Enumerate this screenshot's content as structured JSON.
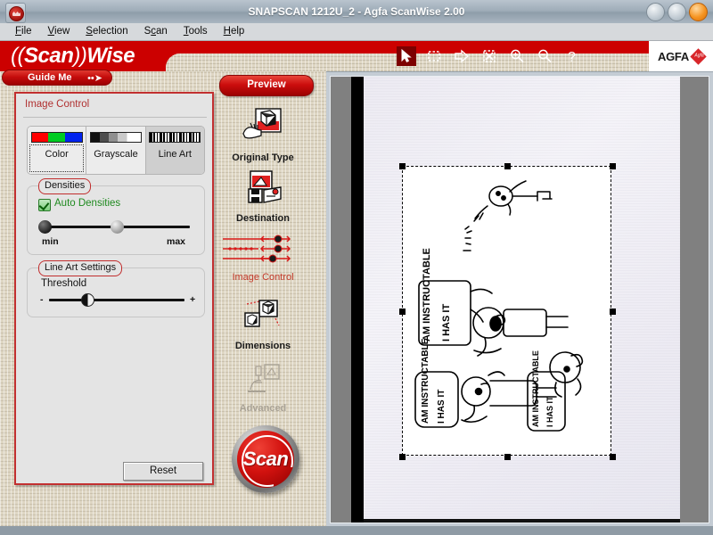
{
  "window": {
    "title": "SNAPSCAN 1212U_2 - Agfa ScanWise 2.00",
    "system_icon": "scanwise-app-icon",
    "buttons": [
      {
        "name": "minimize-button",
        "glyph": ""
      },
      {
        "name": "maximize-button",
        "glyph": ""
      },
      {
        "name": "close-button",
        "glyph": ""
      }
    ]
  },
  "menu": {
    "items": [
      {
        "label": "File",
        "mnemonic": "F"
      },
      {
        "label": "View",
        "mnemonic": "V"
      },
      {
        "label": "Selection",
        "mnemonic": "S"
      },
      {
        "label": "Scan",
        "mnemonic": "c"
      },
      {
        "label": "Tools",
        "mnemonic": "T"
      },
      {
        "label": "Help",
        "mnemonic": "H"
      }
    ]
  },
  "banner": {
    "logo_prefix": "((",
    "logo_scan": "Scan",
    "logo_paren": "))",
    "logo_wise": "Wise",
    "brand": "AGFA",
    "brand_mark": "Agfa",
    "toolbar": [
      {
        "name": "arrow-select-tool",
        "title": "Select",
        "selected": true
      },
      {
        "name": "marquee-tool",
        "title": "Marquee",
        "selected": false
      },
      {
        "name": "arrow-right-tool",
        "title": "Next",
        "selected": false
      },
      {
        "name": "clear-selection-tool",
        "title": "Clear",
        "selected": false
      },
      {
        "name": "zoom-in-tool",
        "title": "Zoom In",
        "selected": false
      },
      {
        "name": "zoom-out-tool",
        "title": "Zoom Out",
        "selected": false
      },
      {
        "name": "help-tool",
        "title": "Help",
        "selected": false
      }
    ]
  },
  "guide_me": {
    "label": "Guide Me",
    "arrow": "••➤"
  },
  "panel": {
    "title": "Image Control",
    "modes": [
      {
        "label": "Color",
        "swatch": "rgb-bars-icon",
        "active": false,
        "focused": true
      },
      {
        "label": "Grayscale",
        "swatch": "gray-ramp-icon",
        "active": false,
        "focused": false
      },
      {
        "label": "Line Art",
        "swatch": "line-art-bars-icon",
        "active": true,
        "focused": false
      }
    ],
    "densities": {
      "caption": "Densities",
      "auto_label": "Auto Densities",
      "auto_checked": true,
      "min_label": "min",
      "max_label": "max",
      "min_value": 0,
      "max_value": 56
    },
    "line_art": {
      "caption": "Line Art Settings",
      "threshold_label": "Threshold",
      "minus": "-",
      "plus": "+",
      "threshold_value": 37
    },
    "reset_label": "Reset"
  },
  "nav": {
    "preview_label": "Preview",
    "items": [
      {
        "label": "Original Type",
        "icon": "original-type-icon",
        "state": "normal"
      },
      {
        "label": "Destination",
        "icon": "destination-icon",
        "state": "normal"
      },
      {
        "label": "Image Control",
        "icon": "image-control-sliders-icon",
        "state": "current"
      },
      {
        "label": "Dimensions",
        "icon": "dimensions-icon",
        "state": "normal"
      },
      {
        "label": "Advanced",
        "icon": "advanced-microscope-icon",
        "state": "disabled"
      }
    ],
    "scan_label": "Scan"
  },
  "preview": {
    "document_description": "scanned hand-drawn comic sketch, rotated 90 degrees",
    "selection": {
      "handles": 8,
      "style": "dashed"
    }
  }
}
